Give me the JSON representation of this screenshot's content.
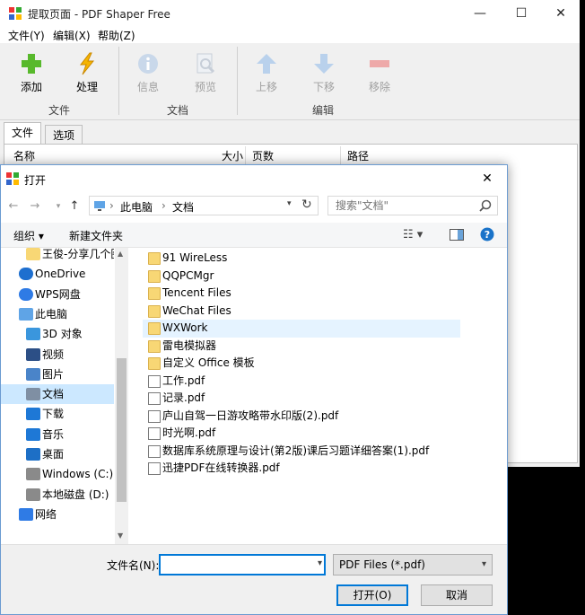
{
  "app": {
    "title": "提取页面 - PDF Shaper Free",
    "controls": {
      "minimize": "—",
      "maximize": "☐",
      "close": "✕"
    },
    "menu": [
      "文件(Y)",
      "编辑(X)",
      "帮助(Z)"
    ],
    "ribbon": {
      "buttons": [
        {
          "label": "添加",
          "enabled": true,
          "icon": "plus-icon"
        },
        {
          "label": "处理",
          "enabled": true,
          "icon": "lightning-icon"
        },
        {
          "label": "信息",
          "enabled": false,
          "icon": "info-icon"
        },
        {
          "label": "预览",
          "enabled": false,
          "icon": "preview-icon"
        },
        {
          "label": "上移",
          "enabled": false,
          "icon": "arrow-up-icon"
        },
        {
          "label": "下移",
          "enabled": false,
          "icon": "arrow-down-icon"
        },
        {
          "label": "移除",
          "enabled": false,
          "icon": "minus-icon"
        }
      ],
      "groups": [
        "文件",
        "文档",
        "编辑"
      ]
    },
    "tabs": [
      "文件",
      "选项"
    ],
    "columns": [
      "名称",
      "大小",
      "页数",
      "路径"
    ]
  },
  "dialog": {
    "title": "打开",
    "close": "✕",
    "breadcrumb": [
      "此电脑",
      "文档"
    ],
    "search_placeholder": "搜索\"文档\"",
    "commands": {
      "organize": "组织 ▾",
      "new_folder": "新建文件夹"
    },
    "nav": [
      {
        "label": "王俊-分享几个图",
        "icon": "folder-icon",
        "indent": 1
      },
      {
        "label": "OneDrive",
        "icon": "onedrive-icon",
        "indent": 0
      },
      {
        "label": "WPS网盘",
        "icon": "wps-cloud-icon",
        "indent": 0
      },
      {
        "label": "此电脑",
        "icon": "computer-icon",
        "indent": 0
      },
      {
        "label": "3D 对象",
        "icon": "3d-objects-icon",
        "indent": 1
      },
      {
        "label": "视频",
        "icon": "video-icon",
        "indent": 1
      },
      {
        "label": "图片",
        "icon": "picture-icon",
        "indent": 1
      },
      {
        "label": "文档",
        "icon": "document-icon",
        "indent": 1,
        "selected": true
      },
      {
        "label": "下载",
        "icon": "download-icon",
        "indent": 1
      },
      {
        "label": "音乐",
        "icon": "music-icon",
        "indent": 1
      },
      {
        "label": "桌面",
        "icon": "desktop-icon",
        "indent": 1
      },
      {
        "label": "Windows (C:)",
        "icon": "drive-icon",
        "indent": 1
      },
      {
        "label": "本地磁盘 (D:)",
        "icon": "drive-icon",
        "indent": 1
      },
      {
        "label": "网络",
        "icon": "network-icon",
        "indent": 0
      }
    ],
    "files": [
      {
        "name": "91 WireLess",
        "type": "folder"
      },
      {
        "name": "QQPCMgr",
        "type": "folder"
      },
      {
        "name": "Tencent Files",
        "type": "folder"
      },
      {
        "name": "WeChat Files",
        "type": "folder"
      },
      {
        "name": "WXWork",
        "type": "folder",
        "selected": true
      },
      {
        "name": "雷电模拟器",
        "type": "folder"
      },
      {
        "name": "自定义 Office 模板",
        "type": "folder"
      },
      {
        "name": "工作.pdf",
        "type": "pdf"
      },
      {
        "name": "记录.pdf",
        "type": "pdf"
      },
      {
        "name": "庐山自驾一日游攻略带水印版(2).pdf",
        "type": "pdf"
      },
      {
        "name": "时光啊.pdf",
        "type": "pdf"
      },
      {
        "name": "数据库系统原理与设计(第2版)课后习题详细答案(1).pdf",
        "type": "pdf"
      },
      {
        "name": "迅捷PDF在线转换器.pdf",
        "type": "pdf"
      }
    ],
    "filename_label": "文件名(N):",
    "filename_value": "",
    "filetype": "PDF Files (*.pdf)",
    "open_button": "打开(O)",
    "cancel_button": "取消"
  },
  "colors": {
    "accent": "#0078d7",
    "selection": "#cce8ff",
    "folder": "#f8d775"
  }
}
